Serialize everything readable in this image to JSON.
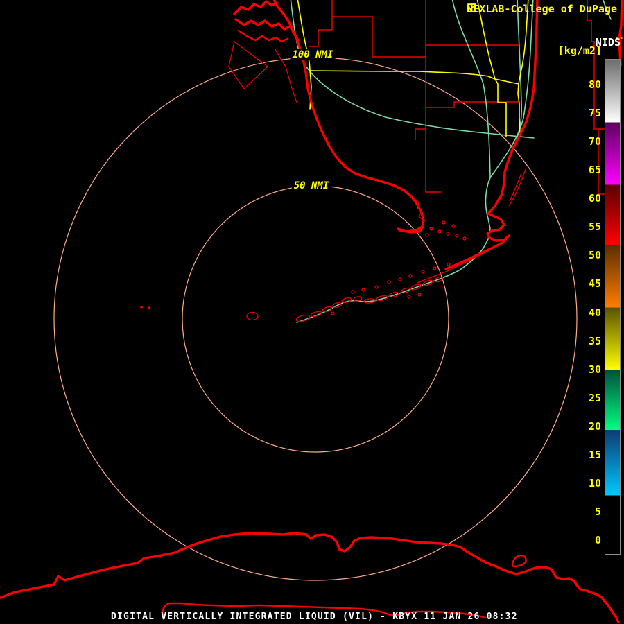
{
  "header": {
    "title": "NEXLAB-College of DuPage",
    "logo_icon": "cod-logo-icon"
  },
  "legend": {
    "source_label": "NIDS",
    "units_label": "[kg/m2]",
    "ticks": [
      80,
      75,
      70,
      65,
      60,
      55,
      50,
      45,
      40,
      35,
      30,
      25,
      20,
      15,
      10,
      5,
      0
    ],
    "segments": [
      {
        "from": 8,
        "to": 19.5,
        "color_bottom": "#00c8ff",
        "color_top": "#0d3a72"
      },
      {
        "from": 19.5,
        "to": 30,
        "color_bottom": "#00ff80",
        "color_top": "#00503c"
      },
      {
        "from": 30,
        "to": 41,
        "color_bottom": "#ffff00",
        "color_top": "#5a5200"
      },
      {
        "from": 41,
        "to": 52,
        "color_bottom": "#ff7d00",
        "color_top": "#5a2d00"
      },
      {
        "from": 52,
        "to": 62.5,
        "color_bottom": "#ff0000",
        "color_top": "#5c0000"
      },
      {
        "from": 62.5,
        "to": 73.5,
        "color_bottom": "#ff00ff",
        "color_top": "#5e0060"
      },
      {
        "from": 73.5,
        "to": 84.4,
        "color_bottom": "#ffffff",
        "color_top": "#6e6e6e"
      }
    ]
  },
  "map": {
    "radar_station": "KBYX",
    "range_rings": [
      {
        "label": "50 NMI",
        "radius_nmi": 50
      },
      {
        "label": "100 NMI",
        "radius_nmi": 100
      }
    ]
  },
  "status_bar": {
    "text": "DIGITAL VERTICALLY INTEGRATED LIQUID (VIL) - KBYX 11 JAN 26 08:32",
    "product_name": "DIGITAL VERTICALLY INTEGRATED LIQUID (VIL)",
    "station": "KBYX",
    "date": "11 JAN 26",
    "time": "08:32"
  },
  "colors": {
    "background": "#000000",
    "coastline": "#fb0000",
    "county_line": "#e80000",
    "road_yellow": "#ffff00",
    "road_green": "#7fd9a4",
    "range_ring": "#ffab8c",
    "ring_label": "#ffff00",
    "header_title": "#ffff00",
    "nids_label": "#ffffff",
    "units_label": "#ffff00",
    "tick_label": "#ffff00",
    "status_text": "#ffffff",
    "colorbar_border": "#8c8c8c"
  }
}
